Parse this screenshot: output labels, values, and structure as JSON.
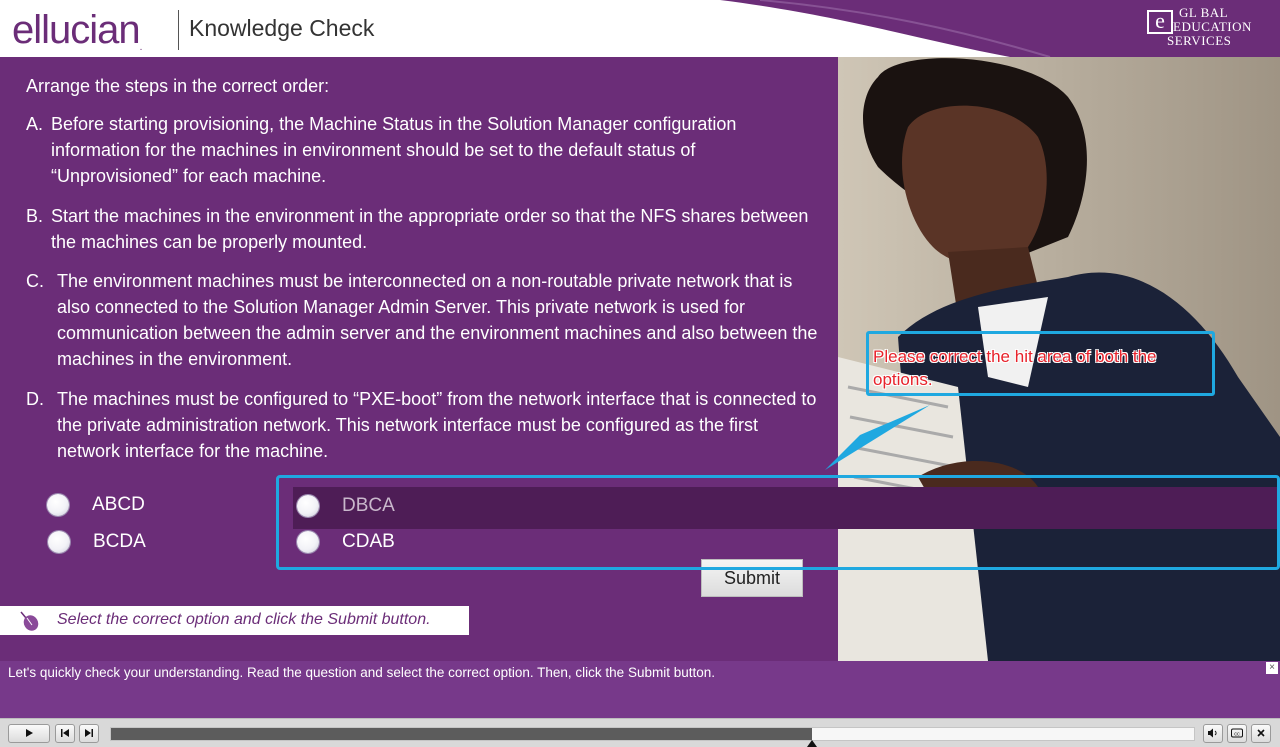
{
  "header": {
    "logo_text": "ellucian",
    "logo_mark": ".",
    "title": "Knowledge Check",
    "partner_logo": {
      "line1": "GL BAL",
      "line2": "EDUCATION",
      "line3": "SERVICES",
      "mark": "e"
    }
  },
  "question": {
    "prompt": "Arrange the steps in the correct order:",
    "steps": [
      {
        "letter": "A.",
        "text": "Before starting provisioning, the Machine Status in the Solution Manager configuration information for the machines in environment should be set to the default status of “Unprovisioned” for each machine."
      },
      {
        "letter": "B.",
        "text": "Start the machines in the environment in the appropriate order so that the NFS shares between the machines can be properly mounted."
      },
      {
        "letter": "C.",
        "text": "The environment machines must be interconnected on a non-routable private network that is also connected to the Solution Manager Admin Server. This private network is used for communication between the admin server and the environment machines and also between the machines in the environment."
      },
      {
        "letter": "D.",
        "text": "The machines must be configured to “PXE-boot” from the network interface that is connected to the private administration network. This network interface must be configured as the first network interface for the machine."
      }
    ]
  },
  "options": [
    {
      "label": "ABCD"
    },
    {
      "label": "BCDA"
    },
    {
      "label": "DBCA"
    },
    {
      "label": "CDAB"
    }
  ],
  "submit_label": "Submit",
  "hint": "Select the correct option and click the Submit button.",
  "callout": "Please correct the hit area of both the options.",
  "caption": "Let's quickly check your understanding. Read the question and select the correct option. Then, click the Submit button.",
  "caption_close": "×",
  "playbar": {
    "progress_fraction": 0.647,
    "icons": [
      "play-icon",
      "rewind-icon",
      "forward-icon",
      "volume-icon",
      "closed-captions-icon",
      "close-icon"
    ]
  },
  "colors": {
    "brand_purple": "#6b2d78",
    "callout_blue": "#1fa8e0",
    "callout_text_red": "#e8222b"
  }
}
